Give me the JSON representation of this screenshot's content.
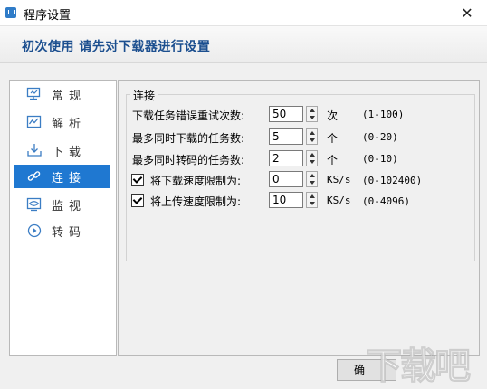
{
  "window": {
    "title": "程序设置",
    "close_glyph": "✕"
  },
  "banner": {
    "text": "初次使用 请先对下载器进行设置"
  },
  "sidebar": {
    "items": [
      {
        "label": "常规",
        "icon": "monitor-icon",
        "selected": false
      },
      {
        "label": "解析",
        "icon": "chart-icon",
        "selected": false
      },
      {
        "label": "下载",
        "icon": "download-icon",
        "selected": false
      },
      {
        "label": "连接",
        "icon": "link-icon",
        "selected": true
      },
      {
        "label": "监视",
        "icon": "eye-monitor-icon",
        "selected": false
      },
      {
        "label": "转码",
        "icon": "convert-icon",
        "selected": false
      }
    ]
  },
  "connection": {
    "group_title": "连接",
    "retry": {
      "label": "下载任务错误重试次数:",
      "value": "50",
      "unit": "次",
      "range": "(1-100)"
    },
    "max_downloads": {
      "label": "最多同时下载的任务数:",
      "value": "5",
      "unit": "个",
      "range": "(0-20)"
    },
    "max_transcode": {
      "label": "最多同时转码的任务数:",
      "value": "2",
      "unit": "个",
      "range": "(0-10)"
    },
    "download_limit": {
      "label": "将下载速度限制为:",
      "value": "0",
      "unit": "KS/s",
      "range": "(0-102400)",
      "checked": true
    },
    "upload_limit": {
      "label": "将上传速度限制为:",
      "value": "10",
      "unit": "KS/s",
      "range": "(0-4096)",
      "checked": true
    }
  },
  "footer": {
    "ok_label": "确"
  },
  "watermark": {
    "text": "下载吧"
  },
  "colors": {
    "accent": "#1f78d1",
    "banner_text": "#1c4f8f"
  }
}
